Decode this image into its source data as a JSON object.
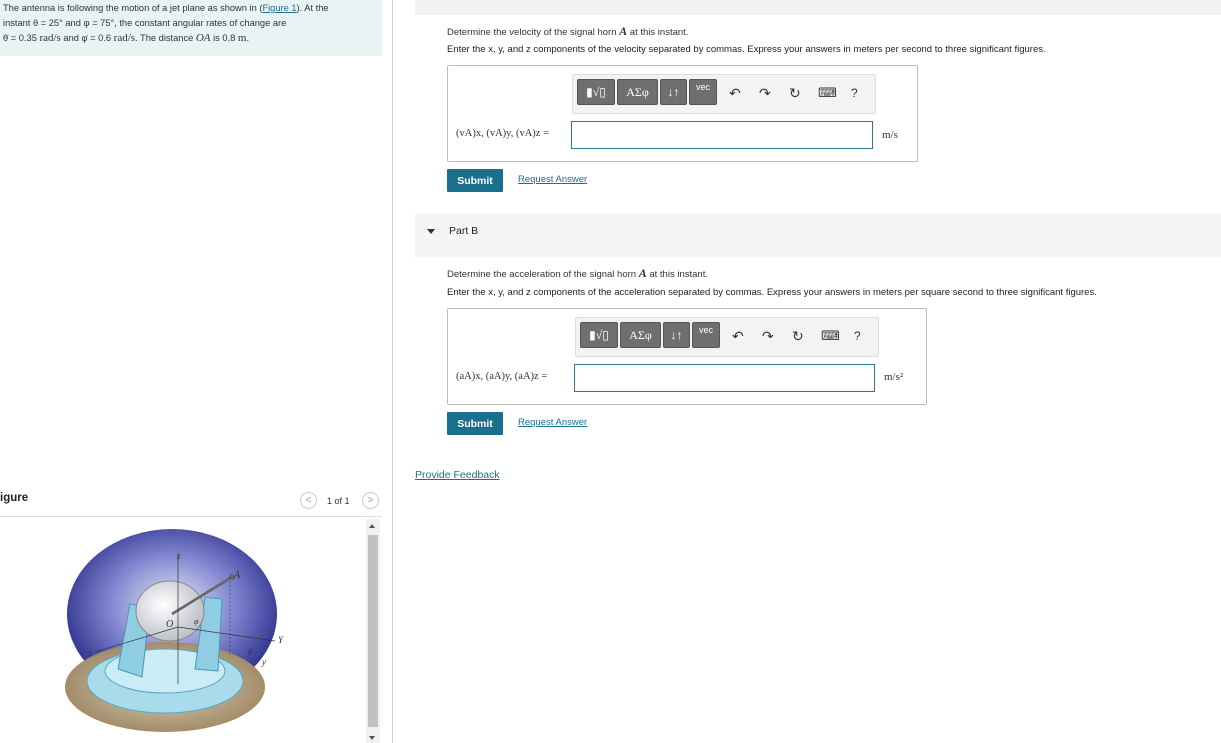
{
  "problem": {
    "line1_pre": "The antenna is following the motion of a jet plane as shown in (",
    "figure_link": "Figure 1",
    "line1_post": "). At the",
    "line2": "instant θ = 25° and φ = 75°, the constant angular rates of change are",
    "line3_a": "θ̇ = 0.35 ",
    "line3_unit1": "rad/s",
    "line3_b": " and φ̇ = 0.6 ",
    "line3_unit2": "rad/s",
    "line3_c": ". The distance ",
    "line3_oa": "OA",
    "line3_d": " is 0.8 ",
    "line3_m": "m",
    "line3_e": "."
  },
  "partA": {
    "question_pre": "Determine the velocity of the signal horn ",
    "question_var": "A",
    "question_post": " at this instant.",
    "instructions": "Enter the x, y, and z components of the velocity separated by commas. Express your answers in meters per second to three significant figures.",
    "answer_label": "(vA)x, (vA)y, (vA)z =",
    "unit": "m/s",
    "submit": "Submit",
    "request": "Request Answer"
  },
  "partB": {
    "title": "Part B",
    "question_pre": "Determine the acceleration of the signal horn ",
    "question_var": "A",
    "question_post": " at this instant.",
    "instructions": "Enter the x, y, and z components of the acceleration separated by commas. Express your answers in meters per square second to three significant figures.",
    "answer_label": "(aA)x, (aA)y, (aA)z =",
    "unit": "m/s²",
    "submit": "Submit",
    "request": "Request Answer"
  },
  "toolbar": {
    "templates": "▮√▯",
    "greek": "ΑΣφ",
    "arrows": "↓↑",
    "vec": "vec",
    "undo": "↶",
    "redo": "↷",
    "reset": "↻",
    "keyboard": "⌨",
    "help": "?"
  },
  "feedback": "Provide Feedback",
  "figure": {
    "title": "igure",
    "count": "1 of 1",
    "prev": "<",
    "next": ">",
    "labels": {
      "z": "z",
      "A": "A",
      "O": "O",
      "phi": "φ",
      "theta": "θ",
      "x": "x",
      "Y": "Y",
      "y": "y"
    }
  },
  "colors": {
    "accent": "#1a6e8e",
    "problem_bg": "#e8f3f3"
  }
}
